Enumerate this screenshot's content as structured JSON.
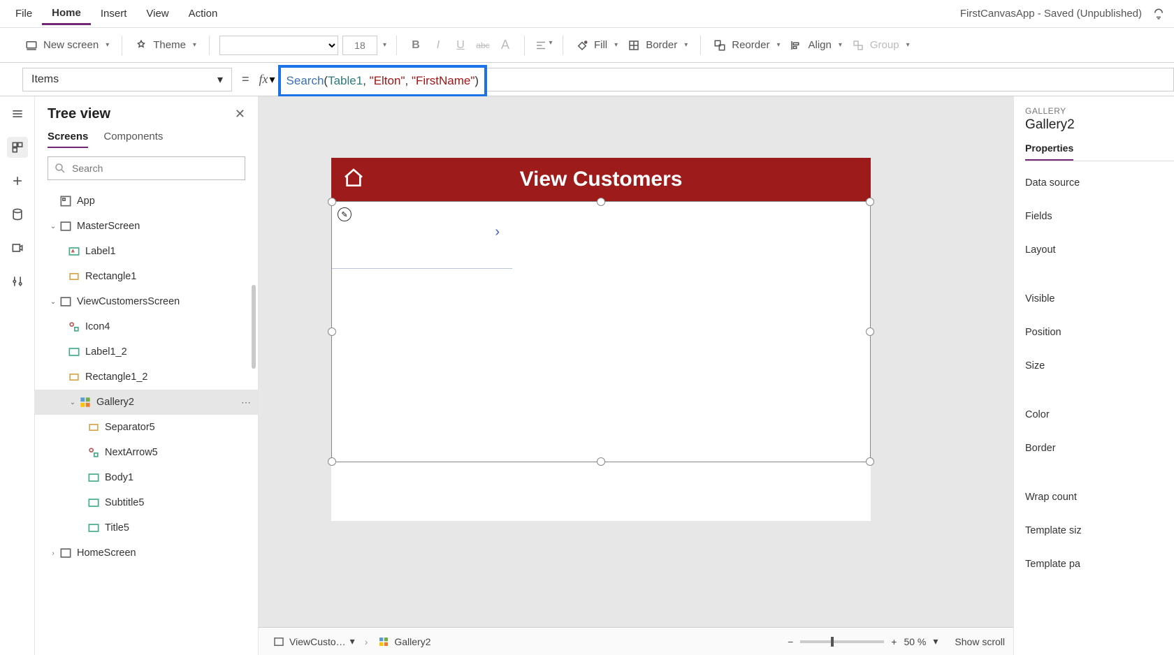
{
  "menubar": {
    "items": [
      "File",
      "Home",
      "Insert",
      "View",
      "Action"
    ],
    "active": "Home",
    "appTitle": "FirstCanvasApp - Saved (Unpublished)"
  },
  "ribbon": {
    "newScreen": "New screen",
    "theme": "Theme",
    "fontSize": "18",
    "fill": "Fill",
    "border": "Border",
    "reorder": "Reorder",
    "align": "Align",
    "group": "Group"
  },
  "formulabar": {
    "property": "Items",
    "fx": "fx",
    "formula_parts": {
      "fn": "Search",
      "open": "(",
      "id": "Table1",
      "c1": ", ",
      "s1": "\"Elton\"",
      "c2": ", ",
      "s2": "\"FirstName\"",
      "close": ")"
    }
  },
  "treeview": {
    "title": "Tree view",
    "tabs": [
      "Screens",
      "Components"
    ],
    "activeTab": "Screens",
    "searchPlaceholder": "Search",
    "nodes": {
      "app": "App",
      "master": "MasterScreen",
      "label1": "Label1",
      "rect1": "Rectangle1",
      "view": "ViewCustomersScreen",
      "icon4": "Icon4",
      "label12": "Label1_2",
      "rect12": "Rectangle1_2",
      "gallery2": "Gallery2",
      "sep5": "Separator5",
      "next5": "NextArrow5",
      "body1": "Body1",
      "subtitle5": "Subtitle5",
      "title5": "Title5",
      "home": "HomeScreen"
    }
  },
  "canvas": {
    "headerTitle": "View Customers"
  },
  "statusbar": {
    "crumb1": "ViewCusto…",
    "crumb2": "Gallery2",
    "zoomPct": "50 %",
    "showScroll": "Show scroll"
  },
  "properties": {
    "kind": "GALLERY",
    "name": "Gallery2",
    "tabs": [
      "Properties"
    ],
    "rows": [
      "Data source",
      "Fields",
      "Layout",
      "Visible",
      "Position",
      "Size",
      "Color",
      "Border",
      "Wrap count",
      "Template siz",
      "Template pa"
    ]
  }
}
